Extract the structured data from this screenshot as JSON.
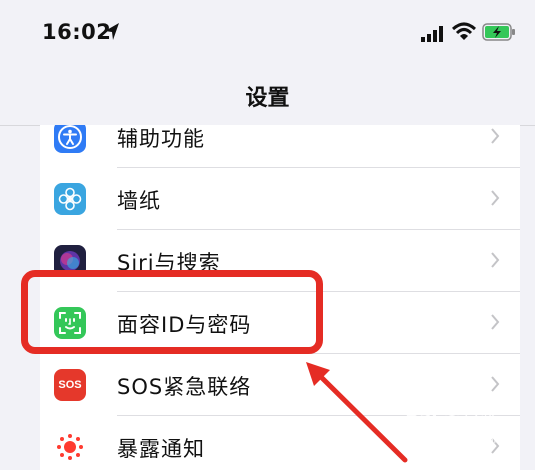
{
  "status_bar": {
    "time": "16:02",
    "icons": [
      "location-arrow-icon",
      "cellular-signal-icon",
      "wifi-icon",
      "battery-charging-icon"
    ]
  },
  "nav": {
    "title": "设置"
  },
  "settings": [
    {
      "label": "辅助功能",
      "icon": "accessibility-icon",
      "color": "#2f7bf5"
    },
    {
      "label": "墙纸",
      "icon": "wallpaper-flower-icon",
      "color": "#3aa5e0"
    },
    {
      "label": "Siri与搜索",
      "icon": "siri-icon",
      "color": "#202040"
    },
    {
      "label": "面容ID与密码",
      "icon": "face-id-icon",
      "color": "#34c759"
    },
    {
      "label": "SOS紧急联络",
      "icon": "sos-icon",
      "icon_text": "SOS",
      "color": "#e5382b"
    },
    {
      "label": "暴露通知",
      "icon": "exposure-notification-icon",
      "color": "#ff3b30"
    }
  ],
  "annotation": {
    "highlight_color": "#e52c24",
    "arrow_target": "面容ID与密码"
  },
  "watermark": {
    "brand_left": "Bai",
    "brand_right": "经验",
    "url": "jingyan.baidu.com"
  }
}
